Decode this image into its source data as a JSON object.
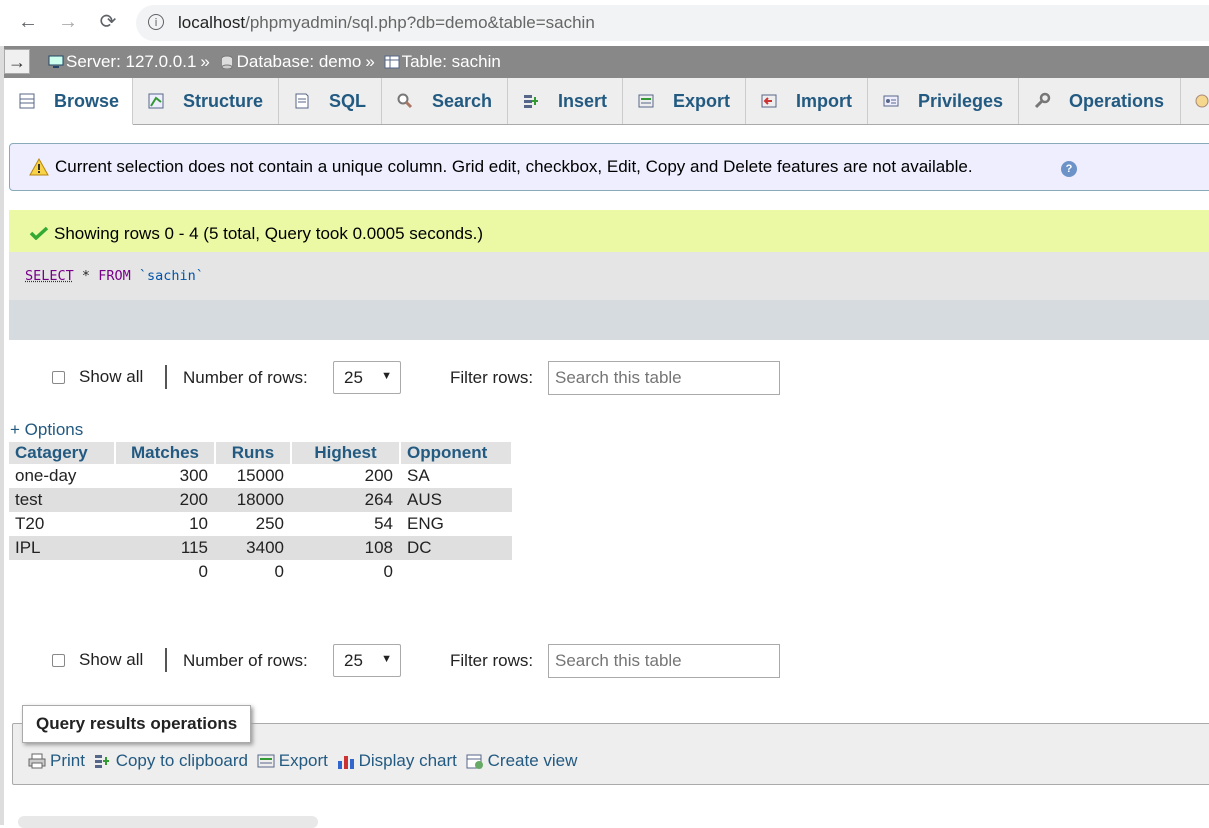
{
  "browser": {
    "url_host": "localhost",
    "url_path": "/phpmyadmin/sql.php?db=demo&table=sachin",
    "back_glyph": "←",
    "forward_glyph": "→",
    "reload_glyph": "⟳",
    "info_glyph": "i"
  },
  "topbar": {
    "collapse_glyph": "→",
    "server": "Server: 127.0.0.1",
    "database": "Database: demo",
    "table": "Table: sachin",
    "separator": "»"
  },
  "tabs": [
    {
      "label": "Browse",
      "icon": "browse-icon",
      "active": true
    },
    {
      "label": "Structure",
      "icon": "structure-icon"
    },
    {
      "label": "SQL",
      "icon": "sql-icon"
    },
    {
      "label": "Search",
      "icon": "search-icon"
    },
    {
      "label": "Insert",
      "icon": "insert-icon"
    },
    {
      "label": "Export",
      "icon": "export-icon"
    },
    {
      "label": "Import",
      "icon": "import-icon"
    },
    {
      "label": "Privileges",
      "icon": "privileges-icon"
    },
    {
      "label": "Operations",
      "icon": "operations-icon"
    }
  ],
  "warning": {
    "text": "Current selection does not contain a unique column. Grid edit, checkbox, Edit, Copy and Delete features are not available.",
    "help_glyph": "?"
  },
  "success": {
    "text": "Showing rows 0 - 4 (5 total, Query took 0.0005 seconds.)"
  },
  "sql": {
    "select": "SELECT",
    "star": "*",
    "from": "FROM",
    "table": "`sachin`"
  },
  "navigation": {
    "show_all": "Show all",
    "number_of_rows_label": "Number of rows:",
    "rows_value": "25",
    "dropdown_glyph": "▼",
    "filter_label": "Filter rows:",
    "filter_placeholder": "Search this table"
  },
  "options_link": "+ Options",
  "results": {
    "columns": [
      "Catagery",
      "Matches",
      "Runs",
      "Highest",
      "Opponent"
    ],
    "rows": [
      [
        "one-day",
        "300",
        "15000",
        "200",
        "SA"
      ],
      [
        "test",
        "200",
        "18000",
        "264",
        "AUS"
      ],
      [
        "T20",
        "10",
        "250",
        "54",
        "ENG"
      ],
      [
        "IPL",
        "115",
        "3400",
        "108",
        "DC"
      ],
      [
        "",
        "0",
        "0",
        "0",
        ""
      ]
    ]
  },
  "query_ops": {
    "legend": "Query results operations",
    "items": [
      {
        "label": "Print",
        "icon": "print-icon"
      },
      {
        "label": "Copy to clipboard",
        "icon": "clipboard-icon"
      },
      {
        "label": "Export",
        "icon": "export-icon"
      },
      {
        "label": "Display chart",
        "icon": "chart-icon"
      },
      {
        "label": "Create view",
        "icon": "view-icon"
      }
    ]
  },
  "colors": {
    "link": "#235a81",
    "success_bg": "#ebf8a4",
    "topbar_bg": "#888888"
  }
}
